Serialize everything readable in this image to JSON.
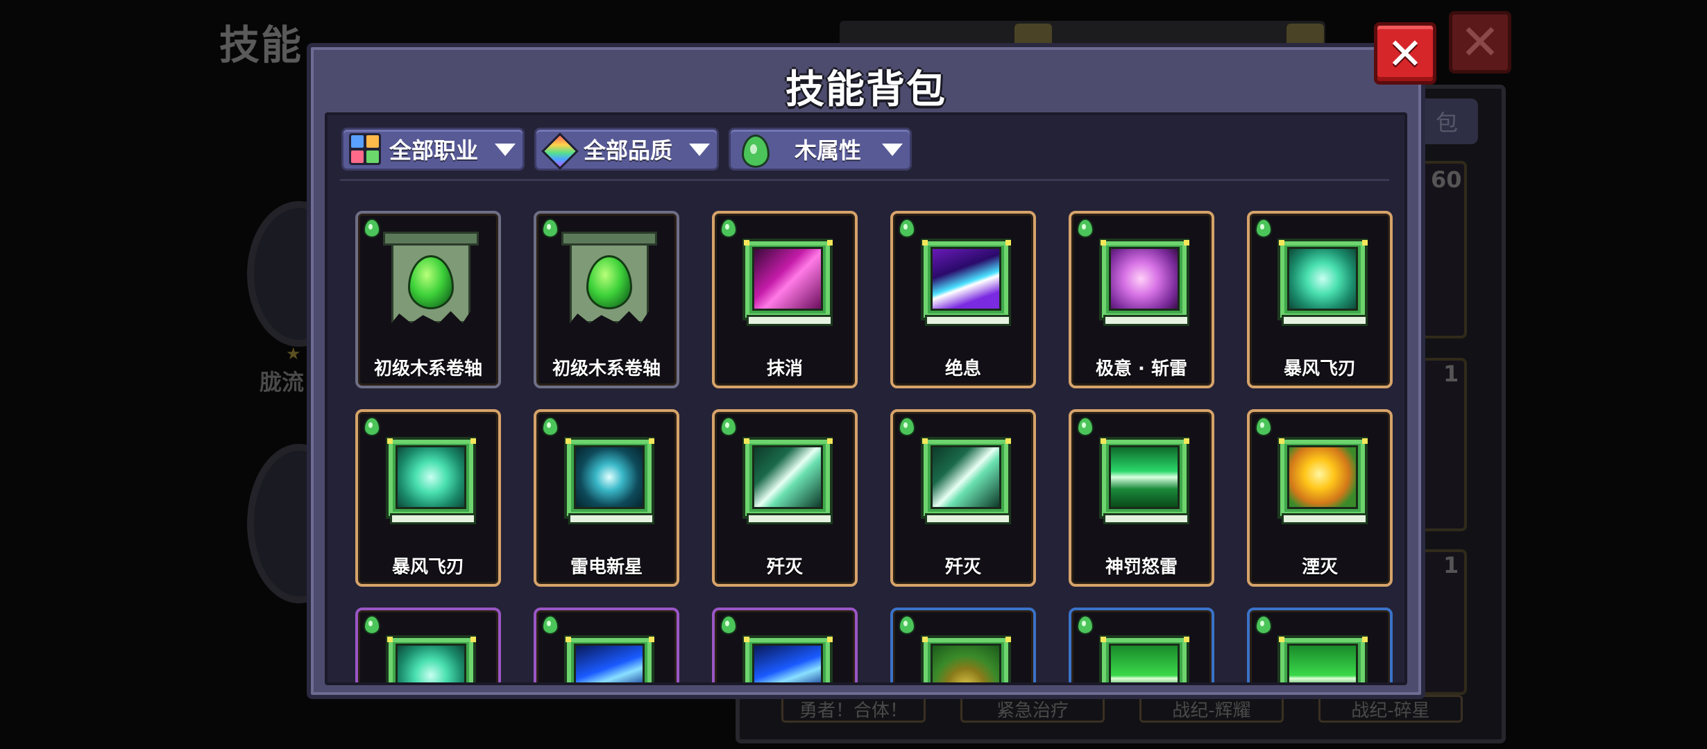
{
  "background": {
    "title": "技能",
    "left_label_1": "胧流",
    "bag_tab": "包",
    "count_60": "60",
    "count_1a": "1",
    "count_1b": "1",
    "bottom_labels": [
      "勇者！合体！",
      "紧急治疗",
      "战纪-辉耀",
      "战纪-碎星"
    ],
    "close_symbol": "✕"
  },
  "modal": {
    "title": "技能背包",
    "close_symbol": "✕"
  },
  "filters": [
    {
      "label": "全部职业",
      "icon": "class-grid-icon"
    },
    {
      "label": "全部品质",
      "icon": "quality-diamond-icon"
    },
    {
      "label": "木属性",
      "icon": "wood-element-icon"
    }
  ],
  "skills": [
    {
      "name": "初级木系卷轴",
      "quality": "gray",
      "art": "scroll"
    },
    {
      "name": "初级木系卷轴",
      "quality": "gray",
      "art": "scroll"
    },
    {
      "name": "抹消",
      "quality": "orange",
      "art": "magenta-slash"
    },
    {
      "name": "绝息",
      "quality": "orange",
      "art": "purple-lightning"
    },
    {
      "name": "极意 · 斩雷",
      "quality": "orange",
      "art": "violet-swirl"
    },
    {
      "name": "暴风飞刃",
      "quality": "orange",
      "art": "green-whirl"
    },
    {
      "name": "暴风飞刃",
      "quality": "orange",
      "art": "green-whirl"
    },
    {
      "name": "雷电新星",
      "quality": "orange",
      "art": "cyan-nova"
    },
    {
      "name": "歼灭",
      "quality": "orange",
      "art": "white-blade"
    },
    {
      "name": "歼灭",
      "quality": "orange",
      "art": "white-blade"
    },
    {
      "name": "神罚怒雷",
      "quality": "orange",
      "art": "green-bolt"
    },
    {
      "name": "湮灭",
      "quality": "orange",
      "art": "golden-orb"
    },
    {
      "name": "",
      "quality": "purple",
      "art": "green-whirl"
    },
    {
      "name": "",
      "quality": "purple",
      "art": "blue-lightning"
    },
    {
      "name": "",
      "quality": "purple",
      "art": "blue-lightning"
    },
    {
      "name": "",
      "quality": "blue",
      "art": "olive-orb"
    },
    {
      "name": "",
      "quality": "blue",
      "art": "green-spike"
    },
    {
      "name": "",
      "quality": "blue",
      "art": "green-spike"
    }
  ],
  "colors": {
    "quality_gray": "#6e6e86",
    "quality_orange": "#d6a36a",
    "quality_purple": "#9a56c6",
    "quality_blue": "#3a72c8",
    "close_red": "#d7262a",
    "panel": "#4e4c6e"
  }
}
